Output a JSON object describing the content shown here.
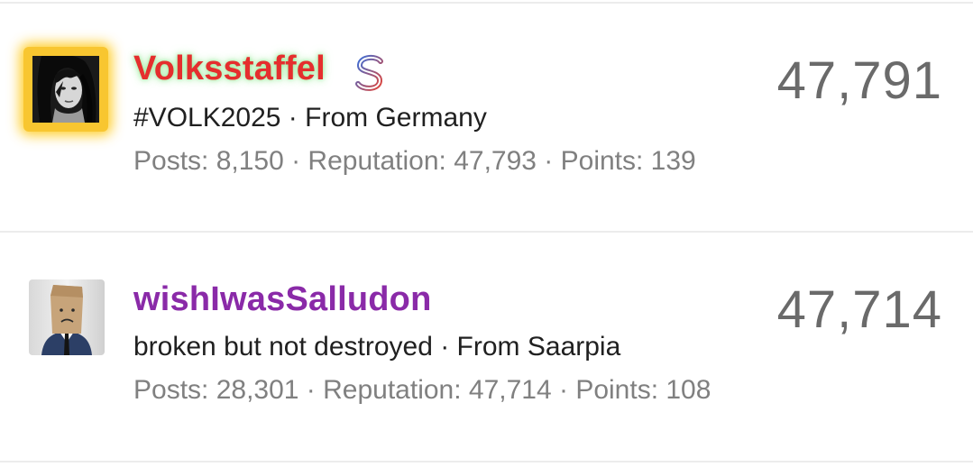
{
  "users": [
    {
      "username": "Volksstaffel",
      "username_color": "#e52e2e",
      "badge_icon": "dollar-icon",
      "tagline": "#VOLK2025 · From Germany",
      "stats": "Posts: 8,150 · Reputation: 47,793 · Points: 139",
      "score": "47,791",
      "avatar_highlight_color": "#f8c630"
    },
    {
      "username": "wishIwasSalludon",
      "username_color": "#8a2aa8",
      "tagline": "broken but not destroyed · From Saarpia",
      "stats": "Posts: 28,301 · Reputation: 47,714 · Points: 108",
      "score": "47,714"
    }
  ]
}
